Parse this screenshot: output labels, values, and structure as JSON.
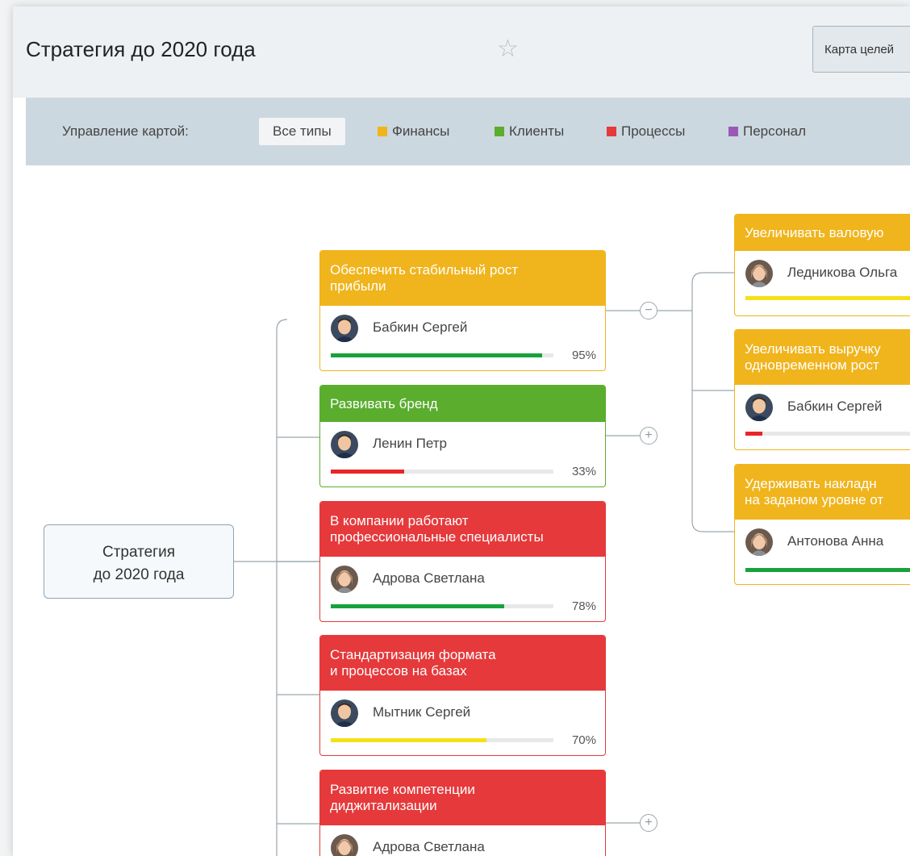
{
  "header": {
    "title": "Стратегия до 2020 года",
    "star_glyph": "☆",
    "map_button_label": "Карта целей"
  },
  "filters": {
    "label": "Управление картой:",
    "items": [
      {
        "label": "Все типы"
      },
      {
        "label": "Финансы",
        "color": "#f0b41c"
      },
      {
        "label": "Клиенты",
        "color": "#5aad2d"
      },
      {
        "label": "Процессы",
        "color": "#e5393b"
      },
      {
        "label": "Персонал",
        "color": "#9b59b6"
      }
    ]
  },
  "colors": {
    "finance": "#f0b41c",
    "clients": "#5aad2d",
    "processes": "#e5393b",
    "progress_green": "#17a23a",
    "progress_red": "#e8252a",
    "progress_yellow": "#f5e01a"
  },
  "root": {
    "title": "Стратегия\nдо 2020 года"
  },
  "goals": [
    {
      "title": "Обеспечить стабильный рост\nприбыли",
      "type": "finance",
      "owner": "Бабкин Сергей",
      "avatar": "avatar-man-icon",
      "progress": 95,
      "progress_text": "95%",
      "progress_color": "green",
      "toggle": "minus"
    },
    {
      "title": "Развивать бренд",
      "type": "clients",
      "owner": "Ленин Петр",
      "avatar": "avatar-man-icon",
      "progress": 33,
      "progress_text": "33%",
      "progress_color": "red",
      "toggle": "plus"
    },
    {
      "title": "В компании работают\nпрофессиональные специалисты",
      "type": "processes",
      "owner": "Адрова Светлана",
      "avatar": "avatar-woman-icon",
      "progress": 78,
      "progress_text": "78%",
      "progress_color": "green"
    },
    {
      "title": "Стандартизация формата\nи процессов на базах",
      "type": "processes",
      "owner": "Мытник Сергей",
      "avatar": "avatar-man-icon",
      "progress": 70,
      "progress_text": "70%",
      "progress_color": "yellow"
    },
    {
      "title": "Развитие компетенции\nдиджитализации",
      "type": "processes",
      "owner": "Адрова Светлана",
      "avatar": "avatar-woman-icon",
      "toggle": "plus"
    }
  ],
  "subgoals": [
    {
      "title": "Увеличивать валовую",
      "owner": "Ледникова Ольга",
      "avatar": "avatar-woman-icon",
      "progress_color": "yellow",
      "progress": 100
    },
    {
      "title": "Увеличивать выручку\nодновременном рост",
      "owner": "Бабкин Сергей",
      "avatar": "avatar-man-icon",
      "progress_color": "red",
      "progress": 8
    },
    {
      "title": "Удерживать накладн\nна заданом уровне от",
      "owner": "Антонова Анна",
      "avatar": "avatar-woman-icon",
      "progress_color": "green",
      "progress": 100
    }
  ],
  "toggle_glyphs": {
    "minus": "−",
    "plus": "+"
  }
}
